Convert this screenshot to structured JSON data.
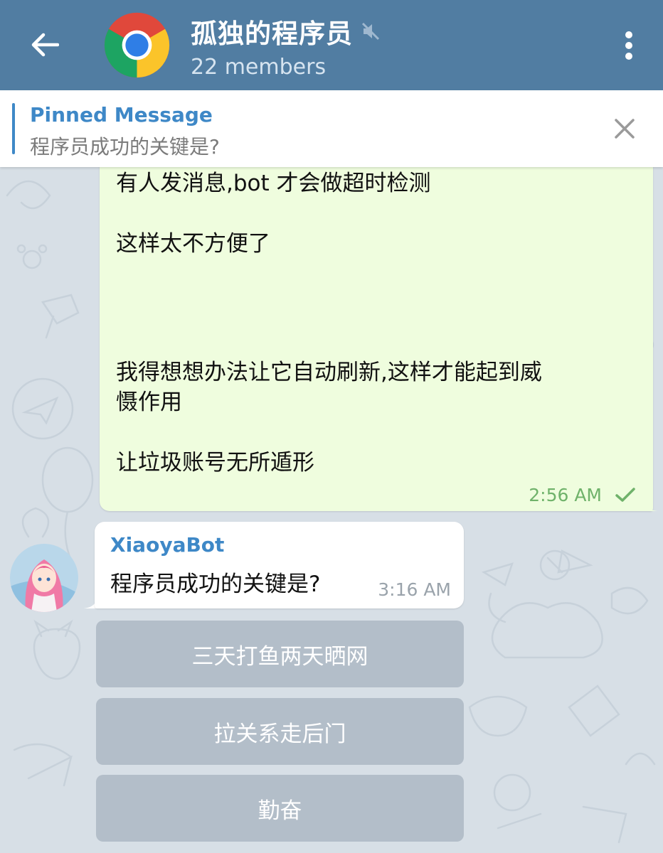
{
  "header": {
    "back_icon": "arrow-left-icon",
    "avatar_icon": "chrome-logo-icon",
    "title": "孤独的程序员",
    "muted_icon": "mute-icon",
    "subtitle": "22 members",
    "menu_icon": "more-vertical-icon"
  },
  "pinned": {
    "label": "Pinned Message",
    "text": "程序员成功的关键是?",
    "close_icon": "close-icon"
  },
  "messages": [
    {
      "direction": "outgoing",
      "lines": [
        "有人发消息,bot 才会做超时检测",
        "这样太不方便了",
        "我得想想办法让它自动刷新,这样才能起到威",
        "慑作用",
        "让垃圾账号无所遁形"
      ],
      "time": "2:56 AM",
      "status_icon": "check-icon"
    },
    {
      "direction": "incoming",
      "sender": "XiaoyaBot",
      "text": "程序员成功的关键是?",
      "time": "3:16 AM"
    }
  ],
  "inline_keyboard": [
    {
      "label": "三天打鱼两天晒网"
    },
    {
      "label": "拉关系走后门"
    },
    {
      "label": "勤奋"
    }
  ],
  "colors": {
    "header_bg": "#517da2",
    "accent": "#3e88c7",
    "outgoing_bubble": "#effdde",
    "chat_bg": "#d7dfe6"
  }
}
